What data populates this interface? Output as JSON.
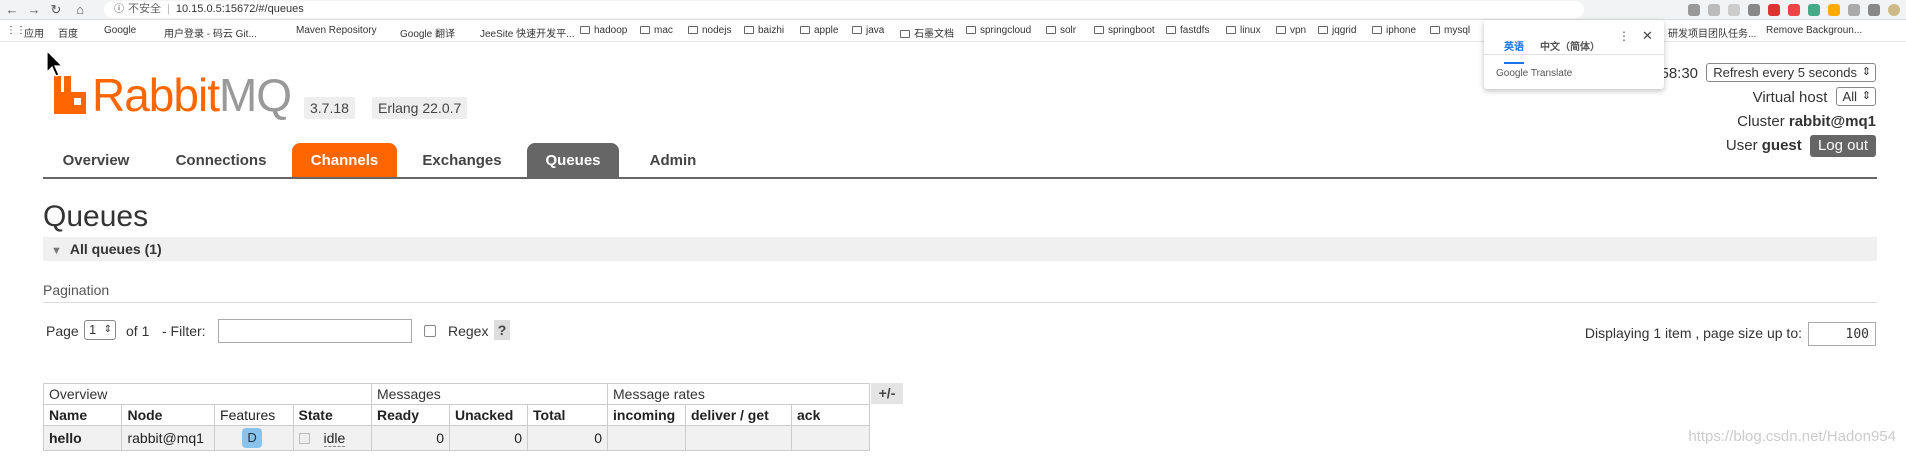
{
  "browser": {
    "insecure_label": "不安全",
    "url": "10.15.0.5:15672/#/queues"
  },
  "bookmarks": [
    "应用",
    "百度",
    "Google",
    "用户登录 - 码云 Git...",
    "Maven Repository",
    "Google 翻译",
    "JeeSite 快速开发平...",
    "hadoop",
    "mac",
    "nodejs",
    "baizhi",
    "apple",
    "java",
    "石墨文档",
    "springcloud",
    "solr",
    "springboot",
    "fastdfs",
    "linux",
    "vpn",
    "jqgrid",
    "iphone",
    "mysql",
    "研发项目团队任务...",
    "Remove Backgroun..."
  ],
  "translate_popup": {
    "tab_english": "英语",
    "tab_chinese": "中文（简体）",
    "brand": "Google Translate"
  },
  "rabbitmq": {
    "logo_rabbit": "Rabbit",
    "logo_mq": "MQ",
    "version": "3.7.18",
    "erlang": "Erlang 22.0.7"
  },
  "header_right": {
    "time_fragment": "58:30",
    "refresh_option": "Refresh every 5 seconds",
    "virtual_host_label": "Virtual host",
    "virtual_host_value": "All",
    "cluster_label": "Cluster",
    "cluster_value": "rabbit@mq1",
    "user_label": "User",
    "user_value": "guest",
    "logout_label": "Log out"
  },
  "tabs": [
    "Overview",
    "Connections",
    "Channels",
    "Exchanges",
    "Queues",
    "Admin"
  ],
  "page": {
    "title": "Queues",
    "section_title": "All queues (1)",
    "pagination_label": "Pagination"
  },
  "paging": {
    "page_label": "Page",
    "page_value": "1",
    "of_label": "of 1",
    "filter_label": "- Filter:",
    "regex_label": "Regex",
    "help_label": "?",
    "displaying_text": "Displaying 1 item , page size up to:",
    "page_size": "100"
  },
  "table": {
    "groups": [
      "Overview",
      "Messages",
      "Message rates"
    ],
    "toggle_label": "+/-",
    "columns": [
      "Name",
      "Node",
      "Features",
      "State",
      "Ready",
      "Unacked",
      "Total",
      "incoming",
      "deliver / get",
      "ack"
    ],
    "rows": [
      {
        "name": "hello",
        "node": "rabbit@mq1",
        "feature": "D",
        "state": "idle",
        "ready": "0",
        "unacked": "0",
        "total": "0",
        "incoming": "",
        "deliver_get": "",
        "ack": ""
      }
    ]
  },
  "watermark": "https://blog.csdn.net/Hadon954",
  "colors": {
    "brand_orange": "#ff6600",
    "tab_active_gray": "#666666",
    "feature_badge": "#8ac4ec"
  }
}
